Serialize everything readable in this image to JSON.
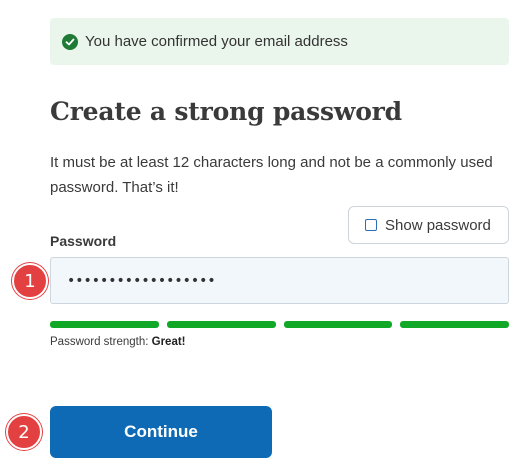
{
  "banner": {
    "icon": "check-circle-icon",
    "message": "You have confirmed your email address",
    "color": "#1e7a34",
    "background": "#eaf6ec"
  },
  "heading": "Create a strong password",
  "description": "It must be at least 12 characters long and not be a commonly used password. That’s it!",
  "show_password": {
    "label": "Show password",
    "checked": false
  },
  "password_field": {
    "label": "Password",
    "value": "••••••••••••••••••"
  },
  "strength": {
    "prefix": "Password strength:",
    "rating": "Great!",
    "segments_filled": 4,
    "segments_total": 4,
    "color": "#10a826"
  },
  "continue_label": "Continue",
  "markers": [
    "1",
    "2"
  ],
  "colors": {
    "primary": "#0f6ab5",
    "marker": "#e34141"
  }
}
